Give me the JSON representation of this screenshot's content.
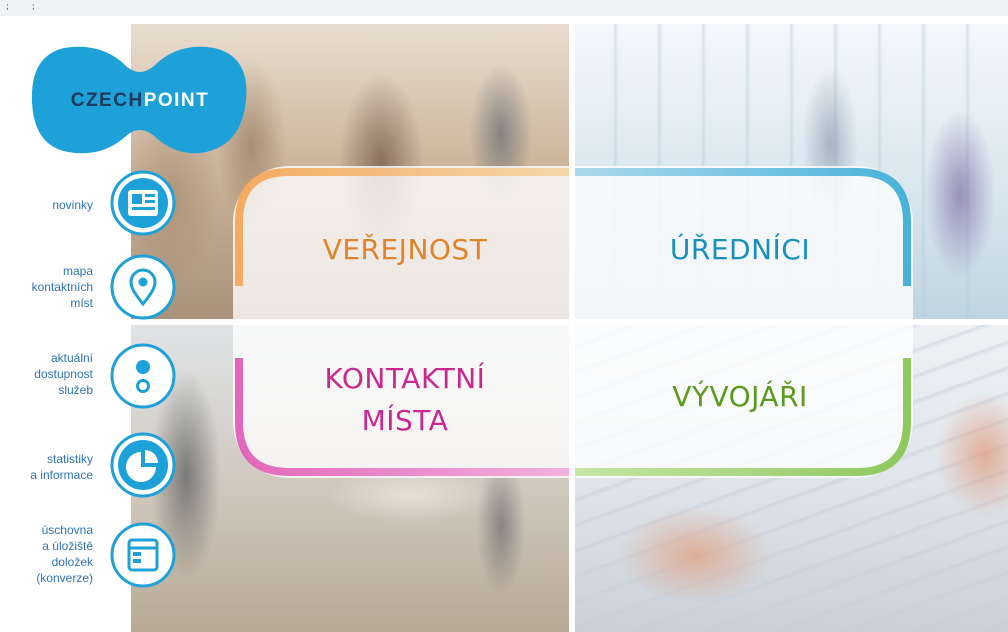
{
  "top_bar": {
    "text": "; ;"
  },
  "logo": {
    "part1": "CZECH",
    "part2": "POINT",
    "color": "#1ea0d8"
  },
  "nav": [
    {
      "label_lines": [
        "novinky"
      ],
      "icon": "newspaper-icon"
    },
    {
      "label_lines": [
        "mapa",
        "kontaktních",
        "míst"
      ],
      "icon": "map-pin-icon"
    },
    {
      "label_lines": [
        "aktuální",
        "dostupnost",
        "služeb"
      ],
      "icon": "service-status-icon"
    },
    {
      "label_lines": [
        "statistiky",
        "a informace"
      ],
      "icon": "pie-chart-icon"
    },
    {
      "label_lines": [
        "úschovna",
        "a úložiště",
        "doložek",
        "(konverze)"
      ],
      "icon": "storage-icon"
    }
  ],
  "tiles": {
    "verejnost": {
      "text": "VEŘEJNOST",
      "color": "#e0832a"
    },
    "urednici": {
      "text": "ÚŘEDNÍCI",
      "color": "#1a8fbf"
    },
    "kontaktni_mista": {
      "line1": "KONTAKTNÍ",
      "line2": "MÍSTA",
      "color": "#c8288f"
    },
    "vyvojari": {
      "text": "VÝVOJÁŘI",
      "color": "#5a9a1e"
    }
  },
  "colors": {
    "accent_blue": "#1ea0d8",
    "nav_text": "#2d73b6"
  }
}
